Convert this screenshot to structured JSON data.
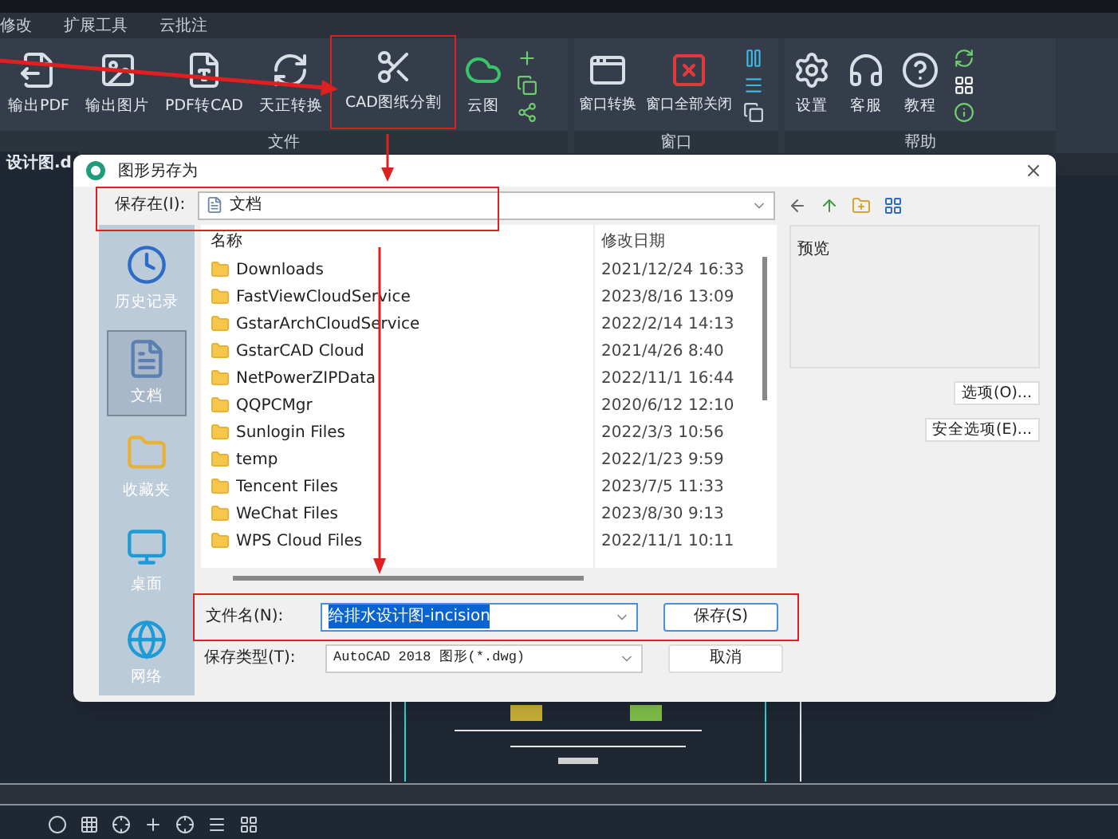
{
  "menu_tabs": [
    {
      "label": "修改"
    },
    {
      "label": "扩展工具"
    },
    {
      "label": "云批注"
    }
  ],
  "ribbon": [
    {
      "title": "文件",
      "buttons": [
        {
          "label": "输出PDF",
          "highlighted": false
        },
        {
          "label": "输出图片",
          "highlighted": false
        },
        {
          "label": "PDF转CAD",
          "highlighted": false
        },
        {
          "label": "天正转换",
          "highlighted": false
        },
        {
          "label": "CAD图纸分割",
          "highlighted": true
        },
        {
          "label": "云图",
          "highlighted": false
        }
      ]
    },
    {
      "title": "窗口",
      "buttons": [
        {
          "label": "窗口转换",
          "highlighted": false
        },
        {
          "label": "窗口全部关闭",
          "highlighted": false
        }
      ]
    },
    {
      "title": "帮助",
      "buttons": [
        {
          "label": "设置",
          "highlighted": false
        },
        {
          "label": "客服",
          "highlighted": false
        },
        {
          "label": "教程",
          "highlighted": false
        }
      ]
    }
  ],
  "doc_tab": {
    "label": "设计图.d"
  },
  "dialog": {
    "title": "图形另存为",
    "save_in_label": "保存在(I):",
    "save_in_value": "文档",
    "places": [
      {
        "label": "历史记录",
        "selected": false
      },
      {
        "label": "文档",
        "selected": true
      },
      {
        "label": "收藏夹",
        "selected": false
      },
      {
        "label": "桌面",
        "selected": false
      },
      {
        "label": "网络",
        "selected": false
      }
    ],
    "columns": [
      "名称",
      "修改日期"
    ],
    "rows": [
      {
        "name": "Downloads",
        "date": "2021/12/24 16:33"
      },
      {
        "name": "FastViewCloudService",
        "date": "2023/8/16 13:09"
      },
      {
        "name": "GstarArchCloudService",
        "date": "2022/2/14 14:13"
      },
      {
        "name": "GstarCAD Cloud",
        "date": "2021/4/26 8:40"
      },
      {
        "name": "NetPowerZIPData",
        "date": "2022/11/1 16:44"
      },
      {
        "name": "QQPCMgr",
        "date": "2020/6/12 12:10"
      },
      {
        "name": "Sunlogin Files",
        "date": "2022/3/3 10:56"
      },
      {
        "name": "temp",
        "date": "2022/1/23 9:59"
      },
      {
        "name": "Tencent Files",
        "date": "2023/7/5 11:33"
      },
      {
        "name": "WeChat Files",
        "date": "2023/8/30 9:13"
      },
      {
        "name": "WPS Cloud Files",
        "date": "2022/11/1 10:11"
      }
    ],
    "preview_label": "预览",
    "option_buttons": [
      "选项(O)...",
      "安全选项(E)..."
    ],
    "filename_label": "文件名(N):",
    "filename_value": "给排水设计图-incision",
    "filetype_label": "保存类型(T):",
    "filetype_value": "AutoCAD 2018 图形(*.dwg)",
    "save_button": "保存(S)",
    "cancel_button": "取消"
  }
}
